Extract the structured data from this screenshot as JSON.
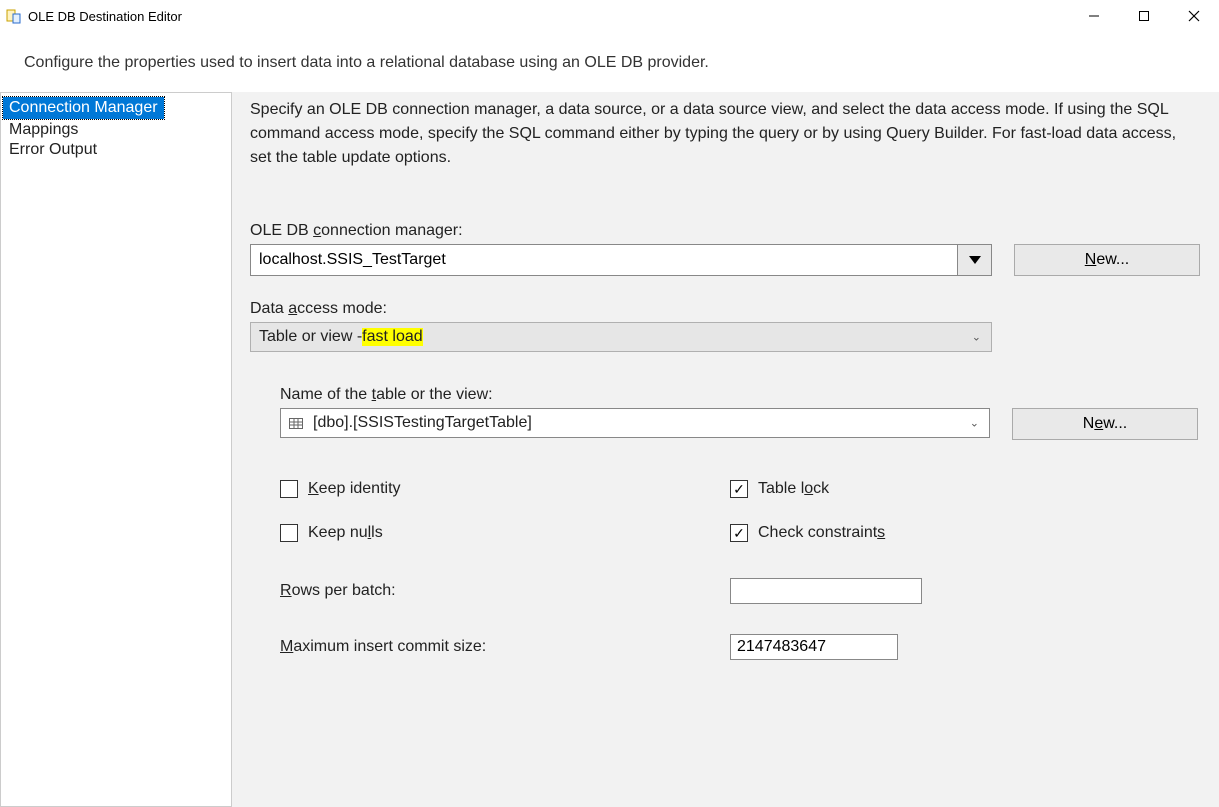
{
  "window": {
    "title": "OLE DB Destination Editor"
  },
  "description": "Configure the properties used to insert data into a relational database using an OLE DB provider.",
  "sidebar": {
    "items": [
      {
        "label": "Connection Manager",
        "selected": true
      },
      {
        "label": "Mappings",
        "selected": false
      },
      {
        "label": "Error Output",
        "selected": false
      }
    ]
  },
  "main": {
    "instructions": "Specify an OLE DB connection manager, a data source, or a data source view, and select the data access mode. If using the SQL command access mode, specify the SQL command either by typing the query or by using Query Builder. For fast-load data access, set the table update options.",
    "connection": {
      "label_pre": "OLE DB ",
      "label_uchar": "c",
      "label_post": "onnection manager:",
      "value": "localhost.SSIS_TestTarget",
      "new_label": "New..."
    },
    "access_mode": {
      "label_pre": "Data ",
      "label_uchar": "a",
      "label_post": "ccess mode:",
      "value_pre": "Table or view - ",
      "value_hl": "fast load"
    },
    "table": {
      "label_pre": "Name of the ",
      "label_uchar": "t",
      "label_post": "able or the view:",
      "value": "[dbo].[SSISTestingTargetTable]",
      "new_label": "New..."
    },
    "checks": {
      "keep_identity": {
        "pre": "",
        "u": "K",
        "post": "eep identity",
        "checked": false
      },
      "keep_nulls": {
        "pre": "Keep nu",
        "u": "l",
        "post": "ls",
        "checked": false
      },
      "table_lock": {
        "pre": "Table l",
        "u": "o",
        "post": "ck",
        "checked": true
      },
      "check_constraints": {
        "pre": "Check constraint",
        "u": "s",
        "post": "",
        "checked": true,
        "highlight": true
      }
    },
    "rows_per_batch": {
      "label_u": "R",
      "label_post": "ows per batch:",
      "value": ""
    },
    "max_commit": {
      "label_u": "M",
      "label_post": "aximum insert commit size:",
      "value": "2147483647",
      "highlight": true
    }
  }
}
